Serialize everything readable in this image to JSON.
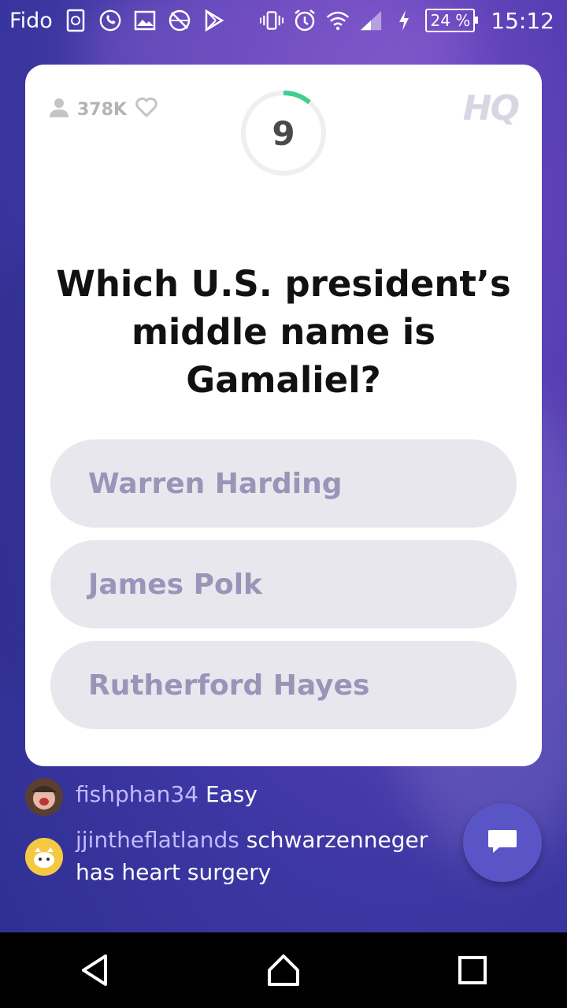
{
  "status_bar": {
    "carrier": "Fido",
    "battery": "24 %",
    "time": "15:12",
    "icons": [
      "sim-icon",
      "whatsapp-icon",
      "gallery-icon",
      "no-sync-icon",
      "play-store-icon",
      "vibrate-icon",
      "alarm-icon",
      "wifi-icon",
      "signal-icon",
      "charging-icon"
    ]
  },
  "card": {
    "viewers": "378K",
    "logo": "HQ",
    "timer": "9",
    "question": "Which U.S. president’s middle name is Gamaliel?",
    "answers": [
      {
        "label": "Warren Harding"
      },
      {
        "label": "James Polk"
      },
      {
        "label": "Rutherford Hayes"
      }
    ]
  },
  "chat": {
    "messages": [
      {
        "user": "fishphan34",
        "text": "Easy"
      },
      {
        "user": "jjintheflatlands",
        "text": "schwarzenneger has heart surgery"
      }
    ]
  },
  "colors": {
    "accent_timer": "#3ecf8e",
    "answer_bg": "#e8e7ee",
    "answer_text": "#9a94b8",
    "chat_user": "#c3baff",
    "fab": "#5a55c7"
  },
  "nav": {
    "icons": [
      "back-icon",
      "home-icon",
      "recents-icon"
    ]
  }
}
